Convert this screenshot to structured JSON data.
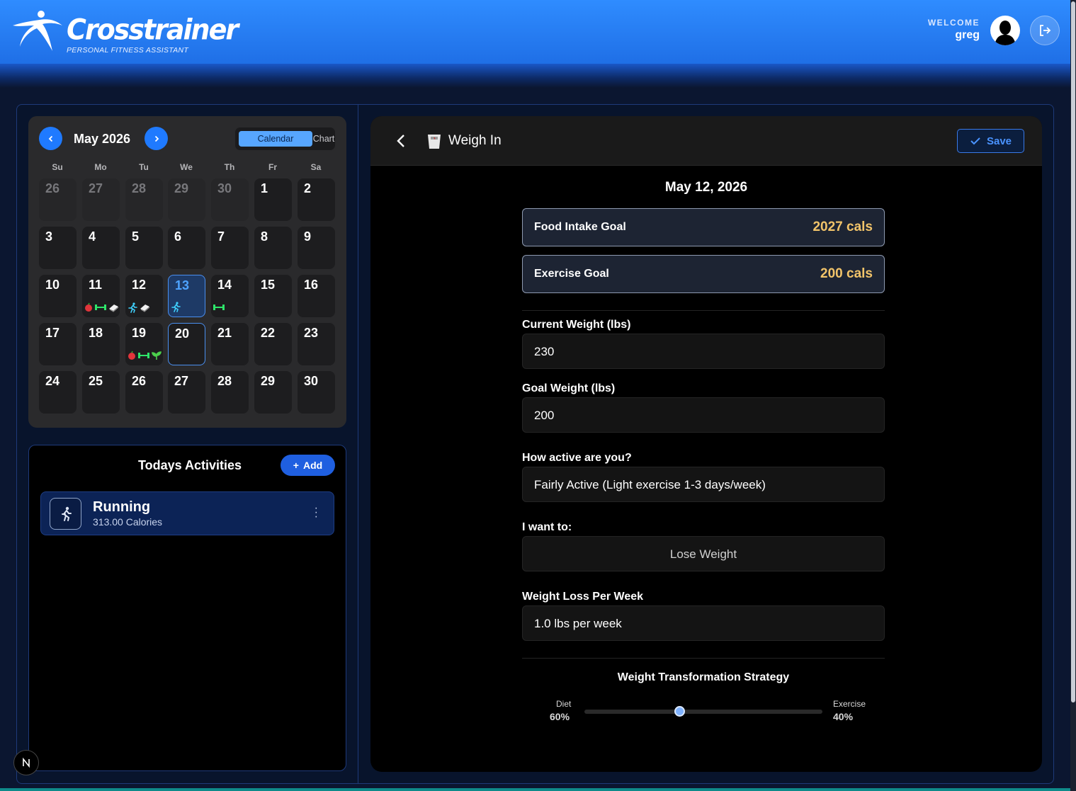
{
  "header": {
    "brand": "Crosstrainer",
    "tagline": "PERSONAL FITNESS ASSISTANT",
    "welcome_label": "WELCOME",
    "username": "greg"
  },
  "calendar": {
    "month_label": "May 2026",
    "view_options": [
      "Calendar",
      "Chart"
    ],
    "active_view": "Calendar",
    "weekdays": [
      "Su",
      "Mo",
      "Tu",
      "We",
      "Th",
      "Fr",
      "Sa"
    ],
    "weeks": [
      [
        {
          "d": "26",
          "muted": true
        },
        {
          "d": "27",
          "muted": true
        },
        {
          "d": "28",
          "muted": true
        },
        {
          "d": "29",
          "muted": true
        },
        {
          "d": "30",
          "muted": true
        },
        {
          "d": "1"
        },
        {
          "d": "2"
        }
      ],
      [
        {
          "d": "3"
        },
        {
          "d": "4"
        },
        {
          "d": "5"
        },
        {
          "d": "6"
        },
        {
          "d": "7"
        },
        {
          "d": "8"
        },
        {
          "d": "9"
        }
      ],
      [
        {
          "d": "10"
        },
        {
          "d": "11",
          "icons": [
            "apple-icon",
            "dumbbell-icon",
            "scale-icon"
          ]
        },
        {
          "d": "12",
          "icons": [
            "runner-icon",
            "scale-icon"
          ]
        },
        {
          "d": "13",
          "selected": true,
          "icons": [
            "runner-icon"
          ]
        },
        {
          "d": "14",
          "icons": [
            "dumbbell-icon"
          ]
        },
        {
          "d": "15"
        },
        {
          "d": "16"
        }
      ],
      [
        {
          "d": "17"
        },
        {
          "d": "18"
        },
        {
          "d": "19",
          "icons": [
            "apple-icon",
            "dumbbell-icon",
            "plant-icon"
          ]
        },
        {
          "d": "20",
          "today": true
        },
        {
          "d": "21"
        },
        {
          "d": "22"
        },
        {
          "d": "23"
        }
      ],
      [
        {
          "d": "24"
        },
        {
          "d": "25"
        },
        {
          "d": "26"
        },
        {
          "d": "27"
        },
        {
          "d": "28"
        },
        {
          "d": "29"
        },
        {
          "d": "30"
        }
      ]
    ]
  },
  "activities": {
    "title": "Todays Activities",
    "add_label": "Add",
    "items": [
      {
        "name": "Running",
        "calories": "313.00 Calories",
        "icon": "runner-icon"
      }
    ]
  },
  "weigh_in": {
    "title": "Weigh In",
    "save_label": "Save",
    "date": "May 12, 2026",
    "food_goal_label": "Food Intake Goal",
    "food_goal_value": "2027 cals",
    "exercise_goal_label": "Exercise Goal",
    "exercise_goal_value": "200 cals",
    "current_weight_label": "Current Weight (lbs)",
    "current_weight_value": "230",
    "goal_weight_label": "Goal Weight (lbs)",
    "goal_weight_value": "200",
    "activity_label": "How active are you?",
    "activity_value": "Fairly Active (Light exercise 1-3 days/week)",
    "want_label": "I want to:",
    "want_value": "Lose Weight",
    "loss_rate_label": "Weight Loss Per Week",
    "loss_rate_value": "1.0 lbs per week",
    "strategy_title": "Weight Transformation Strategy",
    "diet_label": "Diet",
    "diet_pct": "60%",
    "exercise_label": "Exercise",
    "exercise_pct": "40%",
    "diet_fraction": 0.4
  },
  "colors": {
    "accent": "#1f7aff",
    "goal_value": "#f2c46a",
    "apple": "#e0353b",
    "dumbbell": "#2ee56a",
    "runner": "#3fd2ff"
  }
}
